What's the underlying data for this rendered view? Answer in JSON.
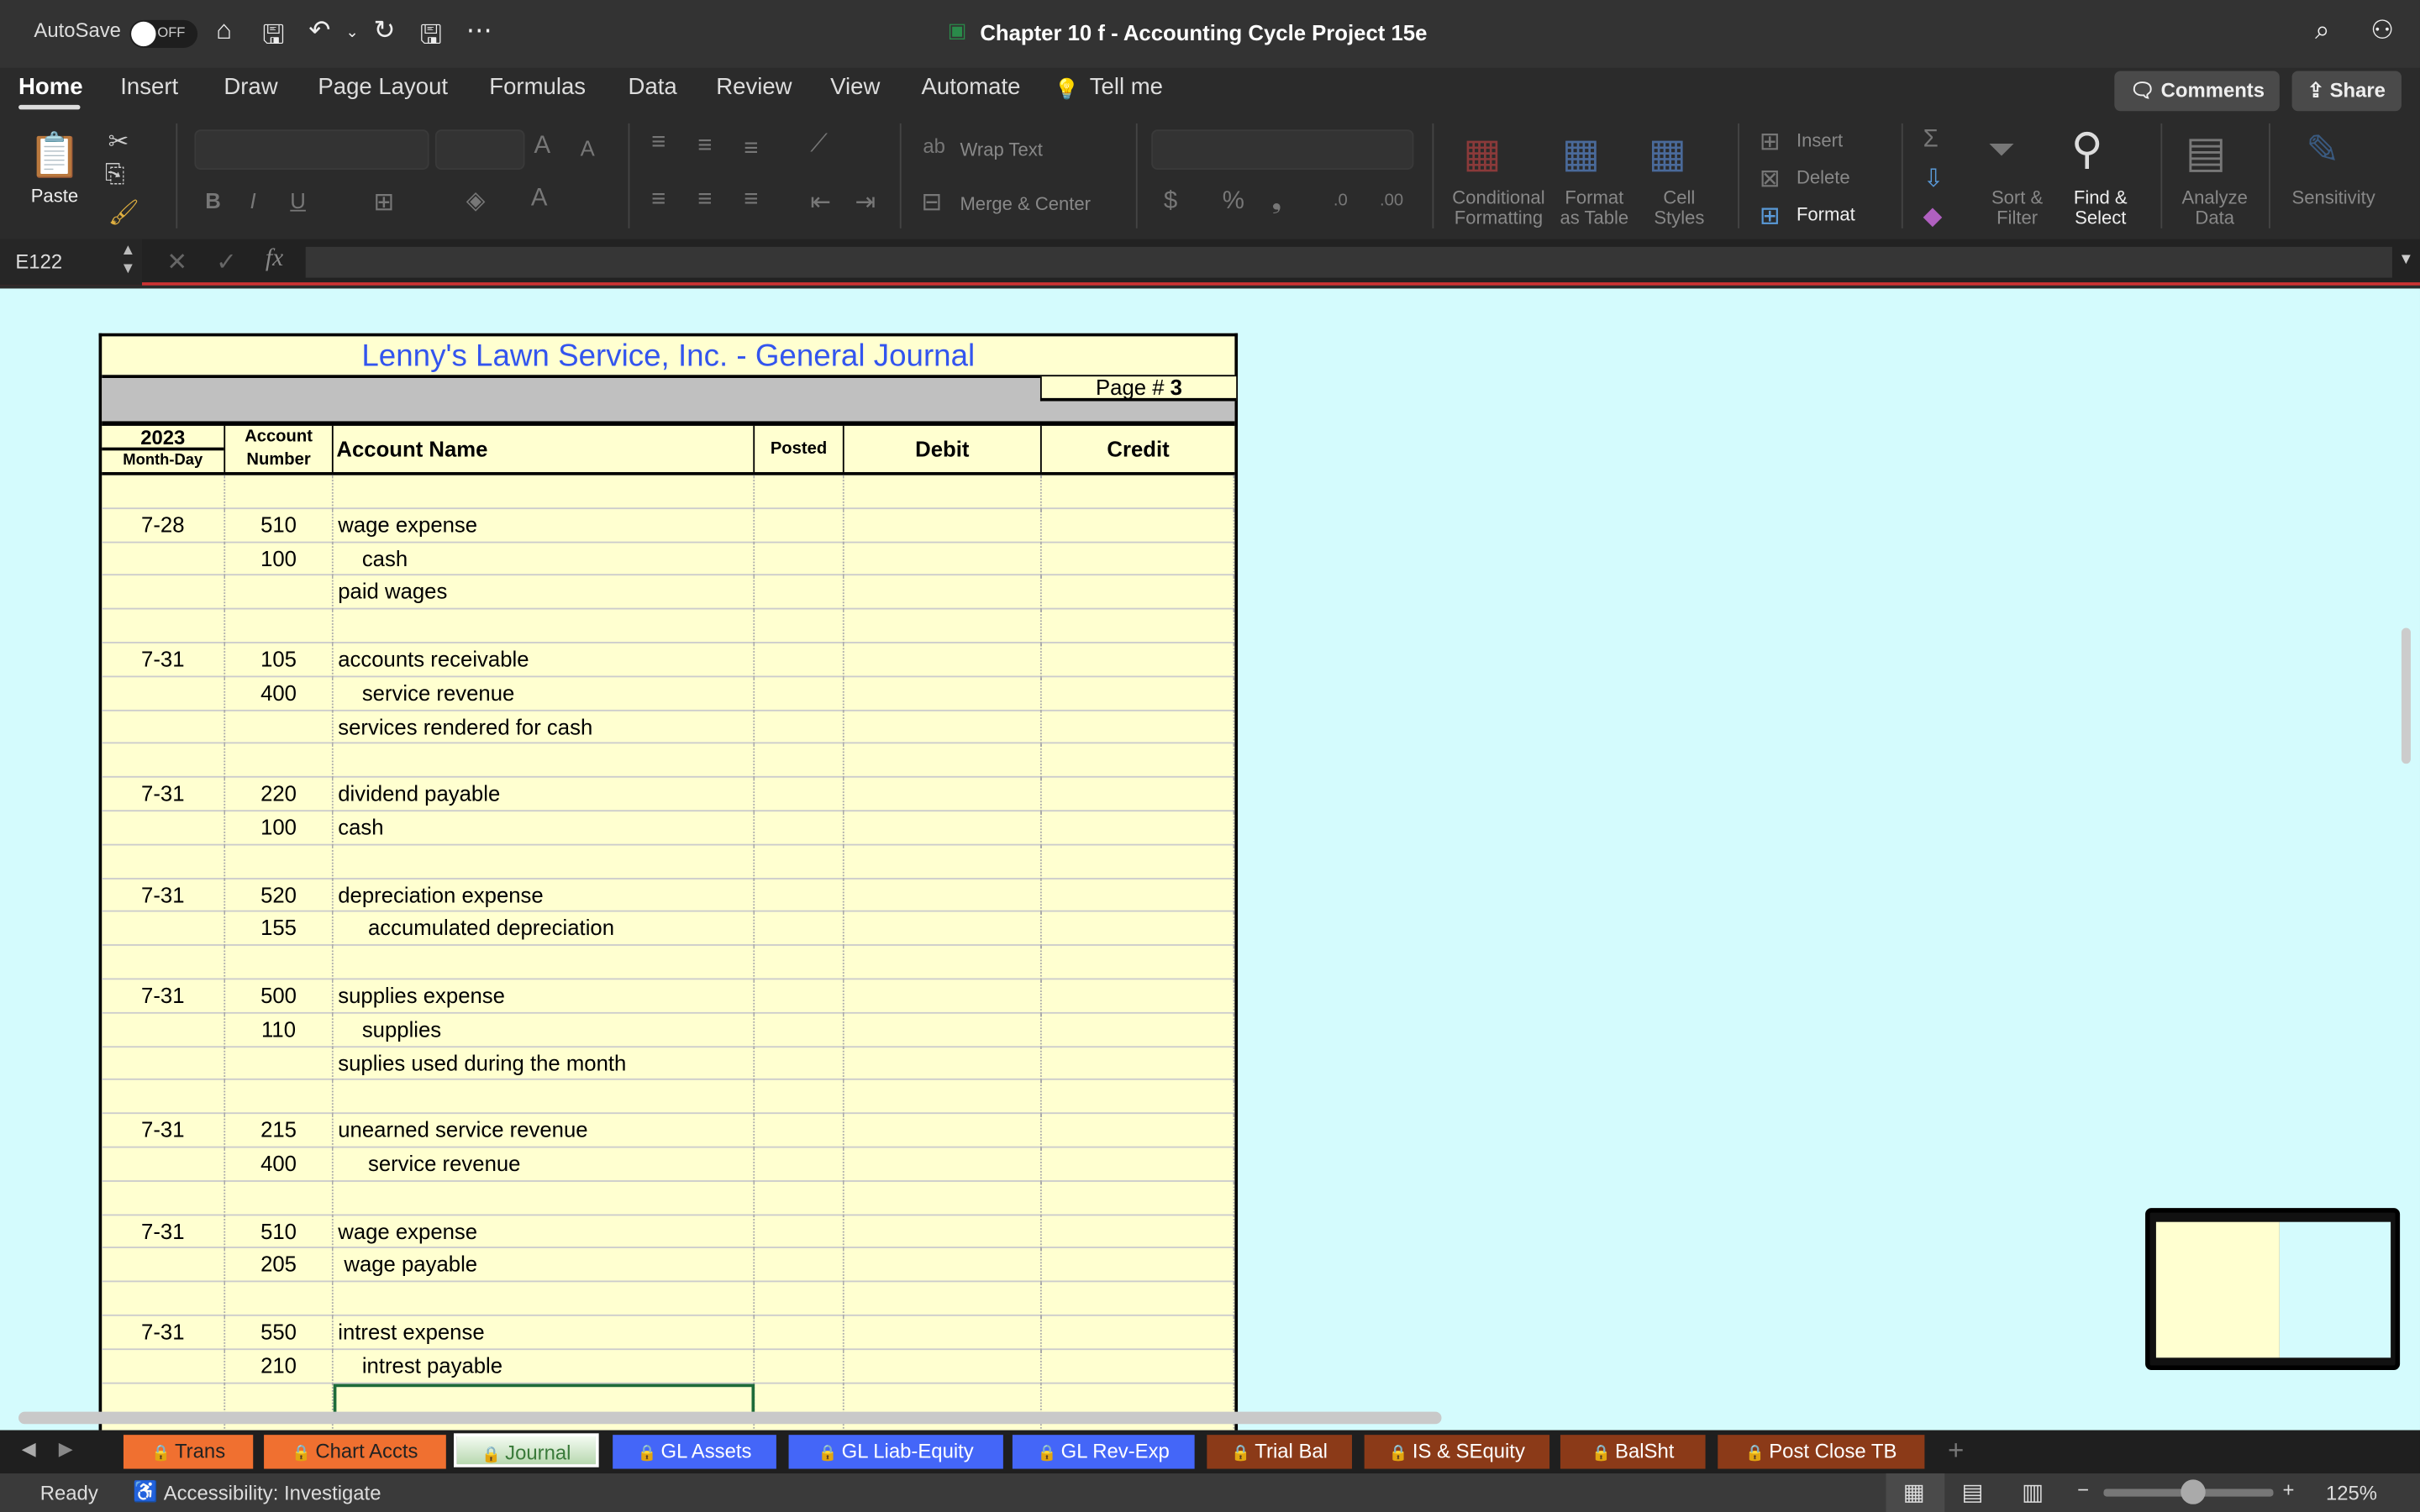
{
  "titlebar": {
    "autosave": "AutoSave",
    "autosave_state": "OFF",
    "doc_title": "Chapter 10 f - Accounting Cycle Project 15e"
  },
  "menu": [
    "Home",
    "Insert",
    "Draw",
    "Page Layout",
    "Formulas",
    "Data",
    "Review",
    "View",
    "Automate",
    "Tell me"
  ],
  "top_buttons": {
    "comments": "Comments",
    "share": "Share"
  },
  "ribbon": {
    "paste": "Paste",
    "wrap_text": "Wrap Text",
    "merge_center": "Merge & Center",
    "currency": "$",
    "percent": "%",
    "conditional_formatting": "Conditional Formatting",
    "format_as_table": "Format as Table",
    "cell_styles": "Cell Styles",
    "insert": "Insert",
    "delete": "Delete",
    "format": "Format",
    "sort_filter": "Sort & Filter",
    "find_select": "Find & Select",
    "analyze_data": "Analyze Data",
    "sensitivity": "Sensitivity"
  },
  "formula_bar": {
    "name_box": "E122",
    "fx": "fx",
    "value": ""
  },
  "journal": {
    "title": "Lenny's Lawn Service, Inc.  -  General Journal",
    "page_label": "Page #",
    "page_number": "3",
    "headers": {
      "year": "2023",
      "month_day": "Month-Day",
      "account": "Account",
      "number": "Number",
      "account_name": "Account Name",
      "posted": "Posted",
      "debit": "Debit",
      "credit": "Credit"
    },
    "rows": [
      [
        "",
        "",
        "",
        "",
        "",
        ""
      ],
      [
        "7-28",
        "510",
        "wage expense",
        "",
        "",
        ""
      ],
      [
        "",
        "100",
        "    cash",
        "",
        "",
        ""
      ],
      [
        "",
        "",
        "paid wages",
        "",
        "",
        ""
      ],
      [
        "",
        "",
        "",
        "",
        "",
        ""
      ],
      [
        "7-31",
        "105",
        "accounts receivable",
        "",
        "",
        ""
      ],
      [
        "",
        "400",
        "    service revenue",
        "",
        "",
        ""
      ],
      [
        "",
        "",
        "services rendered for cash",
        "",
        "",
        ""
      ],
      [
        "",
        "",
        "",
        "",
        "",
        ""
      ],
      [
        "7-31",
        "220",
        "dividend payable",
        "",
        "",
        ""
      ],
      [
        "",
        "100",
        "cash",
        "",
        "",
        ""
      ],
      [
        "",
        "",
        "",
        "",
        "",
        ""
      ],
      [
        "7-31",
        "520",
        "depreciation expense",
        "",
        "",
        ""
      ],
      [
        "",
        "155",
        "     accumulated depreciation",
        "",
        "",
        ""
      ],
      [
        "",
        "",
        "",
        "",
        "",
        ""
      ],
      [
        "7-31",
        "500",
        "supplies expense",
        "",
        "",
        ""
      ],
      [
        "",
        "110",
        "    supplies",
        "",
        "",
        ""
      ],
      [
        "",
        "",
        "suplies used during the month",
        "",
        "",
        ""
      ],
      [
        "",
        "",
        "",
        "",
        "",
        ""
      ],
      [
        "7-31",
        "215",
        "unearned service revenue",
        "",
        "",
        ""
      ],
      [
        "",
        "400",
        "     service revenue",
        "",
        "",
        ""
      ],
      [
        "",
        "",
        "",
        "",
        "",
        ""
      ],
      [
        "7-31",
        "510",
        "wage expense",
        "",
        "",
        ""
      ],
      [
        "",
        "205",
        " wage payable",
        "",
        "",
        ""
      ],
      [
        "",
        "",
        "",
        "",
        "",
        ""
      ],
      [
        "7-31",
        "550",
        "intrest expense",
        "",
        "",
        ""
      ],
      [
        "",
        "210",
        "    intrest payable",
        "",
        "",
        ""
      ],
      [
        "",
        "",
        "",
        "",
        "",
        ""
      ],
      [
        "",
        "",
        "",
        "",
        "",
        ""
      ]
    ],
    "selected_row": 27
  },
  "sheet_tabs": [
    {
      "label": "Trans",
      "color": "#f07030",
      "text": "#222"
    },
    {
      "label": "Chart Accts",
      "color": "#f07030",
      "text": "#222"
    },
    {
      "label": "Journal",
      "color": "#b8d8b0",
      "text": "#3a7a3a",
      "active": true
    },
    {
      "label": "GL Assets",
      "color": "#4466f8",
      "text": "#fff"
    },
    {
      "label": "GL Liab-Equity",
      "color": "#4466f8",
      "text": "#fff"
    },
    {
      "label": "GL Rev-Exp",
      "color": "#4466f8",
      "text": "#fff"
    },
    {
      "label": "Trial Bal",
      "color": "#8b3a18",
      "text": "#fff"
    },
    {
      "label": "IS & SEquity",
      "color": "#8b3a18",
      "text": "#fff"
    },
    {
      "label": "BalSht",
      "color": "#8b3a18",
      "text": "#fff"
    },
    {
      "label": "Post Close TB",
      "color": "#8b3a18",
      "text": "#fff"
    }
  ],
  "status": {
    "ready": "Ready",
    "accessibility": "Accessibility: Investigate",
    "zoom": "125%"
  }
}
